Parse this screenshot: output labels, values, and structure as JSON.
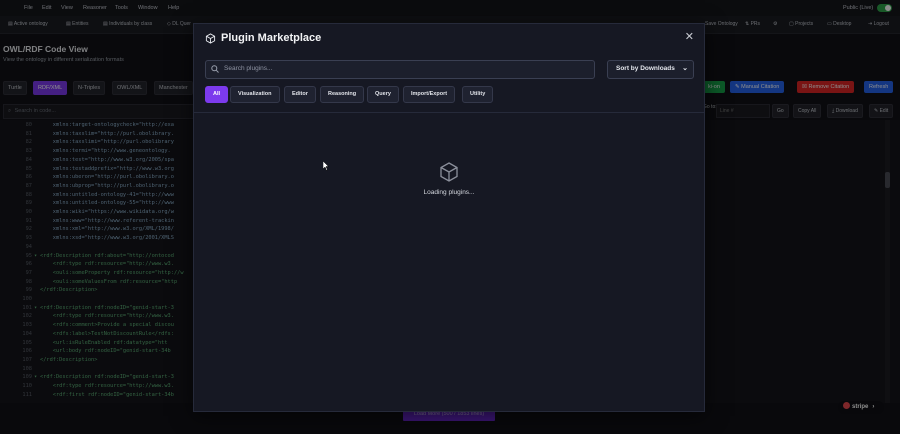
{
  "menubar": {
    "items": [
      "File",
      "Edit",
      "View",
      "Reasoner",
      "Tools",
      "Window",
      "Help"
    ],
    "public_label": "Public (Live)"
  },
  "toolbar": {
    "left": [
      "Active ontology",
      "Entities",
      "Individuals by class",
      "DL Quer"
    ],
    "right": [
      "Save Ontology",
      "PRs",
      "Projects",
      "Desktop",
      "Logout"
    ]
  },
  "header": {
    "title": "OWL/RDF Code View",
    "subtitle": "View the ontology in different serialization formats"
  },
  "format_tabs": [
    "Turtle",
    "RDF/XML",
    "N-Triples",
    "OWL/XML",
    "Manchester"
  ],
  "action_buttons": {
    "plugin": "ki-on",
    "manual_citation": "Manual Citation",
    "remove_citation": "Remove Citation",
    "refresh": "Refresh"
  },
  "code_tools": {
    "search_placeholder": "Search in code...",
    "goto_label": "Go to:",
    "line_placeholder": "Line #",
    "go": "Go",
    "copy_all": "Copy All",
    "download": "Download",
    "edit": "Edit"
  },
  "code_lines": [
    {
      "n": "80",
      "t": "    xmlns:target-ontologycheck=\"http://exa"
    },
    {
      "n": "81",
      "t": "    xmlns:taxslim=\"http://purl.obolibrary."
    },
    {
      "n": "82",
      "t": "    xmlns:taxslimi=\"http://purl.obolibrary"
    },
    {
      "n": "83",
      "t": "    xmlns:termi=\"http://www.geneontology."
    },
    {
      "n": "84",
      "t": "    xmlns:test=\"http://www.w3.org/2005/spa"
    },
    {
      "n": "85",
      "t": "    xmlns:testaddprefix=\"http://www.w3.org"
    },
    {
      "n": "86",
      "t": "    xmlns:uberon=\"http://purl.obolibrary.o"
    },
    {
      "n": "87",
      "t": "    xmlns:ubprop=\"http://purl.obolibrary.o"
    },
    {
      "n": "88",
      "t": "    xmlns:untitled-ontology-41=\"http://www"
    },
    {
      "n": "89",
      "t": "    xmlns:untitled-ontology-55=\"http://www"
    },
    {
      "n": "90",
      "t": "    xmlns:wiki=\"https://www.wikidata.org/w"
    },
    {
      "n": "91",
      "t": "    xmlns:www=\"http://www.referent-trackin"
    },
    {
      "n": "92",
      "t": "    xmlns:xml=\"http://www.w3.org/XML/1998/"
    },
    {
      "n": "93",
      "t": "    xmlns:xsd=\"http://www.w3.org/2001/XMLS"
    },
    {
      "n": "94",
      "t": ""
    },
    {
      "n": "95",
      "t": "<rdf:Description rdf:about=\"http://ontocod"
    },
    {
      "n": "96",
      "t": "    <rdf:type rdf:resource=\"http://www.w3."
    },
    {
      "n": "97",
      "t": "    <ouli:someProperty rdf:resource=\"http://w"
    },
    {
      "n": "98",
      "t": "    <ouli:someValuesFrom rdf:resource=\"http"
    },
    {
      "n": "99",
      "t": "</rdf:Description>"
    },
    {
      "n": "100",
      "t": ""
    },
    {
      "n": "101",
      "t": "<rdf:Description rdf:nodeID=\"genid-start-3"
    },
    {
      "n": "102",
      "t": "    <rdf:type rdf:resource=\"http://www.w3."
    },
    {
      "n": "103",
      "t": "    <rdfs:comment>Provide a special discou"
    },
    {
      "n": "104",
      "t": "    <rdfs:label>TestNotDiscountRule</rdfs:"
    },
    {
      "n": "105",
      "t": "    <url:isRuleEnabled rdf:datatype=\"htt"
    },
    {
      "n": "106",
      "t": "    <url:body rdf:nodeID=\"genid-start-34b"
    },
    {
      "n": "107",
      "t": "</rdf:Description>"
    },
    {
      "n": "108",
      "t": ""
    },
    {
      "n": "109",
      "t": "<rdf:Description rdf:nodeID=\"genid-start-3"
    },
    {
      "n": "110",
      "t": "    <rdf:type rdf:resource=\"http://www.w3."
    },
    {
      "n": "111",
      "t": "    <rdf:first rdf:nodeID=\"genid-start-34b"
    }
  ],
  "load_more": "Load More (500 / 1853 lines)",
  "stripe_label": "stripe",
  "modal": {
    "title": "Plugin Marketplace",
    "search_placeholder": "Search plugins...",
    "sort_label": "Sort by Downloads",
    "categories": [
      "All",
      "Visualization",
      "Editor",
      "Reasoning",
      "Query",
      "Import/Export",
      "Utility"
    ],
    "loading_text": "Loading plugins..."
  },
  "colors": {
    "accent": "#7c3aed",
    "citation": "#2563eb",
    "remove": "#dc2626",
    "plugin": "#16a34a"
  }
}
